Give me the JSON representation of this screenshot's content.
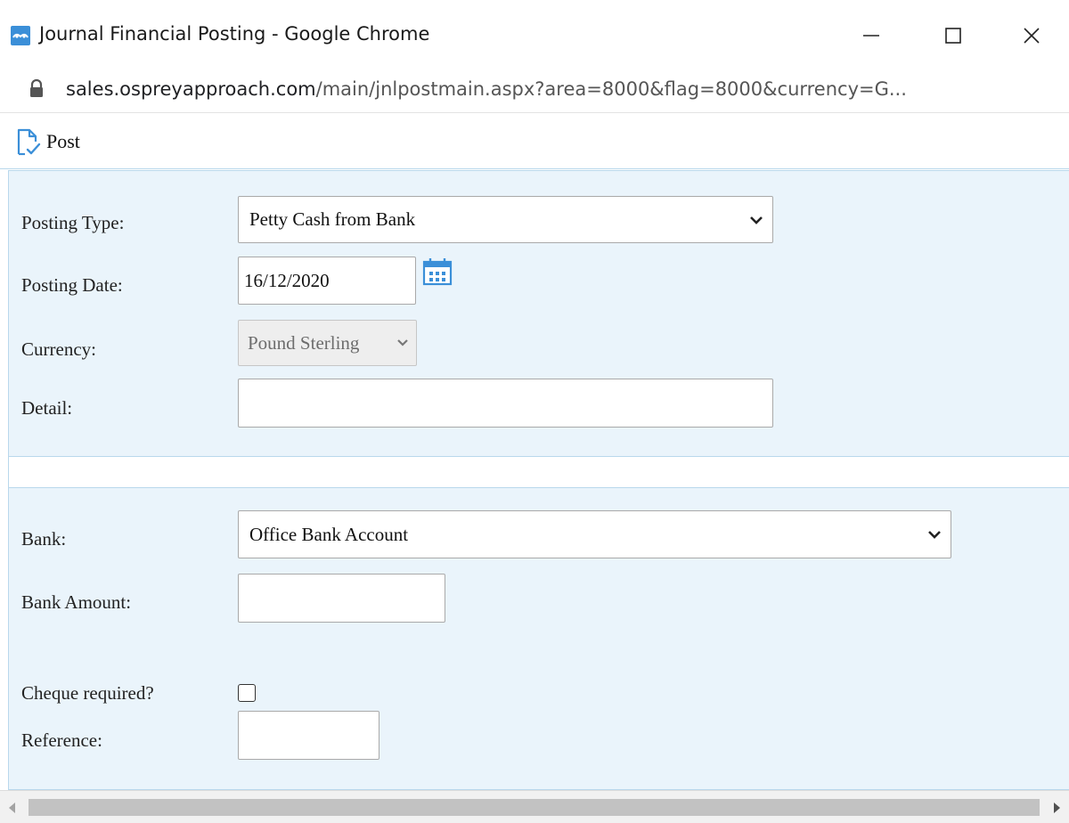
{
  "window": {
    "title": "Journal Financial Posting - Google Chrome",
    "icons": {
      "app": "osprey-app-icon",
      "minimize": "minimize-icon",
      "maximize": "maximize-icon",
      "close": "close-icon"
    }
  },
  "address_bar": {
    "host": "sales.ospreyapproach.com",
    "path": "/main/jnlpostmain.aspx?area=8000&flag=8000&currency=G...",
    "icon": "lock-icon"
  },
  "toolbar": {
    "post_label": "Post",
    "post_icon": "document-check-icon"
  },
  "form": {
    "posting_type": {
      "label": "Posting Type:",
      "value": "Petty Cash from Bank"
    },
    "posting_date": {
      "label": "Posting Date:",
      "value": "16/12/2020",
      "icon": "calendar-icon"
    },
    "currency": {
      "label": "Currency:",
      "value": "Pound Sterling",
      "disabled": true
    },
    "detail": {
      "label": "Detail:",
      "value": ""
    }
  },
  "bank_section": {
    "bank": {
      "label": "Bank:",
      "value": "Office Bank Account"
    },
    "bank_amount": {
      "label": "Bank Amount:",
      "value": ""
    },
    "cheque_required": {
      "label": "Cheque required?",
      "checked": false
    },
    "reference": {
      "label": "Reference:",
      "value": ""
    }
  },
  "colors": {
    "panel_background": "#eaf4fb",
    "panel_border": "#b9d8ec",
    "accent": "#3b8fd8"
  }
}
